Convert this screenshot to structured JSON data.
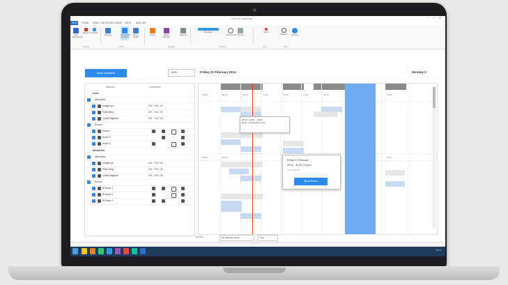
{
  "window": {
    "title": "Outlook Calendar",
    "controls": [
      "–",
      "□",
      "✕"
    ]
  },
  "ribbon_tabs": [
    "FILE",
    "HOME",
    "SEND / RECEIVE",
    "FOLDER",
    "VIEW",
    "ADD-INS"
  ],
  "ribbon": {
    "buttons": [
      {
        "label": "New Appointment",
        "color": "#2b6cc4"
      },
      {
        "label": "Delete",
        "color": "#c0392b"
      },
      {
        "label": "Forward",
        "color": "#4a90d9"
      },
      {
        "label": "Meeting",
        "color": "#3a7bd5"
      },
      {
        "label": "Scheduling Assistant",
        "color": "#2d8ceb"
      },
      {
        "label": "Room Finder",
        "color": "#e67e22"
      },
      {
        "label": "Teams",
        "color": "#8e44ad"
      },
      {
        "label": "Skype Meeting",
        "color": "#2d8ceb"
      },
      {
        "label": "Show As",
        "color": "#7f8c8d"
      },
      {
        "label": "Reminder",
        "color": "#3498db"
      },
      {
        "label": "Recurrence",
        "color": "#95a5a6"
      },
      {
        "label": "Private",
        "color": "#34495e"
      },
      {
        "label": "Zoom",
        "color": "#2980b9"
      },
      {
        "label": "Options",
        "color": "#7f8c8d"
      }
    ],
    "groups": [
      "Actions",
      "Show",
      "Meeting",
      "Options",
      "Tags",
      "Zoom"
    ]
  },
  "toolbar": {
    "send_invitation": "Send invitation",
    "zoom": "100%"
  },
  "calendar": {
    "date_left": "Friday 21 February 2014",
    "date_right": "Monday 2",
    "time_labels": [
      "08:00",
      "09:00",
      "10:00",
      "11:00",
      "12:00",
      "13:00",
      "14:00",
      "15:00"
    ],
    "tooltip_line1": "08:00 - 10:00 — 10:00",
    "tooltip_line2": "Room: meeting Room 1b",
    "popup": {
      "line1": "Friday 21 February",
      "line2": "09:30 - 10:30 (1 hour)",
      "line3": "No conflicts",
      "book_label": "Book Room"
    }
  },
  "attendees": {
    "col_attendee": "Attendee",
    "col_department": "Department",
    "sections": [
      {
        "label": "Lund",
        "attendees_label": "Attendees",
        "people": [
          {
            "name": "kongho pe",
            "dept": "IDE / SW / 08"
          },
          {
            "name": "Peter Berg",
            "dept": "IDE / SW / 08"
          },
          {
            "name": "Johan Hägerfel",
            "dept": "IDE / SW / 08"
          }
        ],
        "rooms_label": "Rooms",
        "rooms": [
          "Room 1",
          "Room 2",
          "Room 3"
        ]
      },
      {
        "label": "Stockholm",
        "attendees_label": "Attendees",
        "people": [
          {
            "name": "kongho pe",
            "dept": "IDE / SW / 08"
          },
          {
            "name": "Peter Berg",
            "dept": "IDE / SW / 08"
          },
          {
            "name": "Johan Hägerfel",
            "dept": "IDE / SW / 08"
          }
        ],
        "rooms_label": "Rooms",
        "rooms": [
          "B Room 1",
          "B Room 2",
          "B Room 3"
        ]
      }
    ]
  },
  "footer": {
    "label": "Booking",
    "select1": "My Calendar Week",
    "select2": "1 day"
  },
  "taskbar": {
    "tray_time": "10:39"
  }
}
